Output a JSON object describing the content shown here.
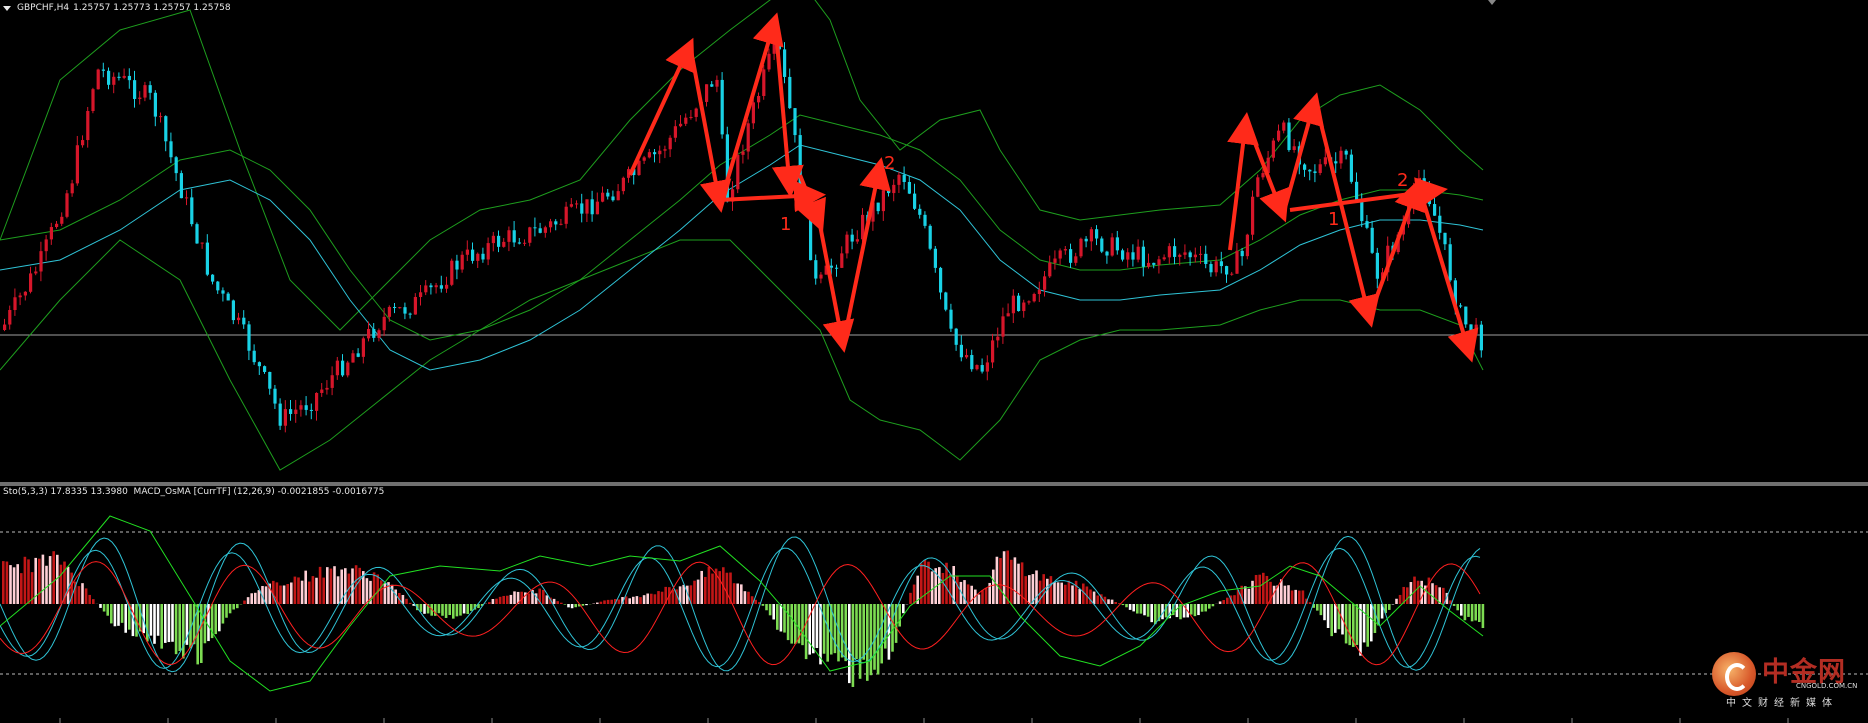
{
  "main_chart": {
    "symbol_text": "GBPCHF,H4",
    "ohlc_text": "1.25757 1.25773 1.25757 1.25758"
  },
  "indicator": {
    "title_text": "Sto(5,3,3) 17.8335 13.3980  MACD_OsMA [CurrTF] (12,26,9) -0.0021855 -0.0016775"
  },
  "annotations": {
    "label_1a": "1",
    "label_2a": "2",
    "label_1b": "1",
    "label_2b": "2"
  },
  "logo": {
    "name": "中金网",
    "url": "CNGOLD.COM.CN",
    "subtitle": "中文财经新媒体"
  },
  "colors": {
    "bull_candle": "#d6162a",
    "bear_candle": "#19d2e6",
    "bollinger": "#1e9e1e",
    "moving_average": "#2fc3d6",
    "arrows": "#ff2a1a",
    "osma_positive_dark": "#c21616",
    "osma_positive_light": "#ffd0d6",
    "osma_negative_light": "#7ddc52",
    "osma_negative_dark": "#ffffff",
    "stoch_main": "#2fc3d6",
    "stoch_signal": "#ff2020",
    "macd_green": "#22e022"
  },
  "chart_data": [
    {
      "type": "candlestick",
      "symbol": "GBPCHF",
      "timeframe": "H4",
      "ohlc": [
        1.25757,
        1.25773,
        1.25757,
        1.25758
      ],
      "overlays": [
        "Bollinger Bands",
        "Moving Average"
      ]
    },
    {
      "type": "bar",
      "indicators": [
        "Sto(5,3,3)",
        "MACD_OsMA [CurrTF] (12,26,9)"
      ],
      "stochastic_values": [
        17.8335,
        13.398
      ],
      "macd_osma_values": [
        -0.0021855,
        -0.0016775
      ]
    }
  ]
}
